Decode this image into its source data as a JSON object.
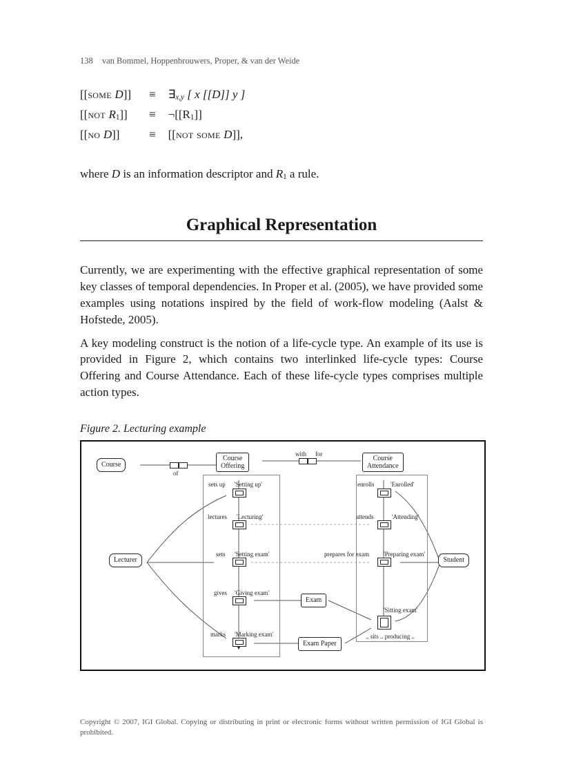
{
  "page": {
    "number": "138",
    "running_head": "van Bommel, Hoppenbrouwers, Proper, & van der Weide"
  },
  "defs": {
    "row1": {
      "lhs_open": "[[",
      "lhs_sc": "some ",
      "lhs_var": "D",
      "lhs_close": "]]",
      "eq": "≡",
      "rhs": "∃",
      "rhs_sub": "x,y",
      "rhs_rest": " [ x [[D]] y ]"
    },
    "row2": {
      "lhs_open": "[[",
      "lhs_sc": "not ",
      "lhs_var": "R",
      "lhs_sub": "1",
      "lhs_close": "]]",
      "eq": "≡",
      "rhs": "¬[[R",
      "rhs_sub2": "1",
      "rhs_end": "]]"
    },
    "row3": {
      "lhs_open": "[[",
      "lhs_sc": "no ",
      "lhs_var": "D",
      "lhs_close": "]]",
      "eq": "≡",
      "rhs_open": "[[",
      "rhs_sc": "not some ",
      "rhs_var": "D",
      "rhs_close": "]],"
    }
  },
  "where_sentence": {
    "pre": "where ",
    "D": "D",
    "mid": " is an information descriptor and ",
    "R": "R",
    "sub": "1",
    "post": " a rule."
  },
  "section": {
    "title": "Graphical Representation"
  },
  "para1": "Currently, we are experimenting with the effective graphical representation of some key classes of temporal dependencies. In Proper et al. (2005), we have provided some examples using notations inspired by the field of work-flow modeling (Aalst & Hofstede, 2005).",
  "para2": "A key modeling construct is the notion of a life-cycle type. An example of its use is provided in Figure 2, which contains two interlinked life-cycle types: Course Offering and Course Attendance. Each of these life-cycle types comprises multiple action types.",
  "figure": {
    "caption": "Figure 2. Lecturing example",
    "course": "Course",
    "course_offering": "Course\nOffering",
    "course_attendance": "Course\nAttendance",
    "lecturer": "Lecturer",
    "student": "Student",
    "exam": "Exam",
    "exam_paper": "Exam Paper",
    "with": "with",
    "for": "for",
    "of": "of",
    "sets_up": "sets up",
    "setting_up": "'Setting up'",
    "lectures": "lectures",
    "lecturing": "'Lecturing'",
    "sets": "sets",
    "setting_exam": "'Setting exam'",
    "gives": "gives",
    "giving_exam": "'Giving exam'",
    "marks": "marks",
    "marking_exam": "'Marking exam'",
    "enrolls": "enrolls",
    "enrolled": "'Enrolled'",
    "attends": "attends",
    "attending": "'Attending'",
    "prepares": "prepares for exam",
    "preparing": "'Preparing exam'",
    "sitting": "'Sitting exam'",
    "sits_producing": ".. sits .. producing .."
  },
  "copyright": "Copyright © 2007, IGI Global. Copying or distributing in print or electronic forms without written permission of IGI Global is prohibited."
}
